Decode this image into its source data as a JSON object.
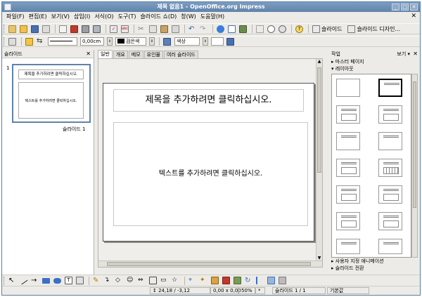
{
  "window": {
    "title": "제목 없음1 - OpenOffice.org Impress"
  },
  "menu": {
    "items": [
      "파일(F)",
      "편집(E)",
      "보기(V)",
      "삽입(I)",
      "서식(O)",
      "도구(T)",
      "슬라이드 쇼(D)",
      "창(W)",
      "도움말(H)"
    ]
  },
  "toolbar1": {
    "slide_label": "슬라이드",
    "slide_design_label": "슬라이드 디자인..."
  },
  "toolbar2": {
    "line_width": "0,00cm",
    "line_color": "검은색",
    "area_color": "색상"
  },
  "slides_panel": {
    "title": "슬라이드",
    "slide_number": "1",
    "thumb_title": "제목을 추가하려면 클릭하십시오.",
    "thumb_body": "텍스트를 추가하려면 클릭하십시오.",
    "thumb_label": "슬라이드 1"
  },
  "view_tabs": [
    "일반",
    "개요",
    "메모",
    "유인물",
    "여러 슬라이드"
  ],
  "slide": {
    "title_placeholder": "제목을 추가하려면 클릭하십시오.",
    "body_placeholder": "텍스트를 추가하려면 클릭하십시오."
  },
  "task_panel": {
    "title": "작업",
    "view_label": "보기 ▾",
    "sections": [
      "마스터 페이지",
      "레이아웃"
    ],
    "bottom_sections": [
      "사용자 지정 애니메이션",
      "슬라이드 전환"
    ]
  },
  "status": {
    "position": "24,18 / -3,12",
    "size": "0,00 x 0,00",
    "zoom": "50%",
    "modified": "*",
    "page": "슬라이드 1 / 1",
    "master": "기본값"
  },
  "icons": {
    "toolbar1": [
      "new-icon",
      "open-icon",
      "save-icon",
      "email-icon",
      "edit-icon",
      "export-pdf-icon",
      "print-icon",
      "print-direct-icon",
      "spellcheck-icon",
      "autospell-icon",
      "cut-icon",
      "copy-icon",
      "paste-icon",
      "format-paintbrush-icon",
      "undo-icon",
      "redo-icon",
      "chart-icon",
      "table-icon",
      "show-draw-icon",
      "grid-icon",
      "navigator-icon",
      "zoom-icon",
      "help-icon"
    ],
    "toolbar2": [
      "styles-icon",
      "line-icon",
      "arrow-style-icon",
      "area-icon",
      "shadow-icon"
    ],
    "drawbar": [
      "select-icon",
      "line-tool-icon",
      "arrow-line-icon",
      "rectangle-icon",
      "ellipse-icon",
      "text-tool-icon",
      "fontwork-icon",
      "curve-icon",
      "connector-icon",
      "basic-shapes-icon",
      "symbol-shapes-icon",
      "block-arrows-icon",
      "flowchart-icon",
      "callouts-icon",
      "stars-icon",
      "points-icon",
      "gluepoints-icon",
      "fontwork-gallery-icon",
      "from-file-icon",
      "gallery-icon",
      "rotate-icon",
      "alignment-icon",
      "arrange-icon",
      "extrusion-icon"
    ]
  }
}
